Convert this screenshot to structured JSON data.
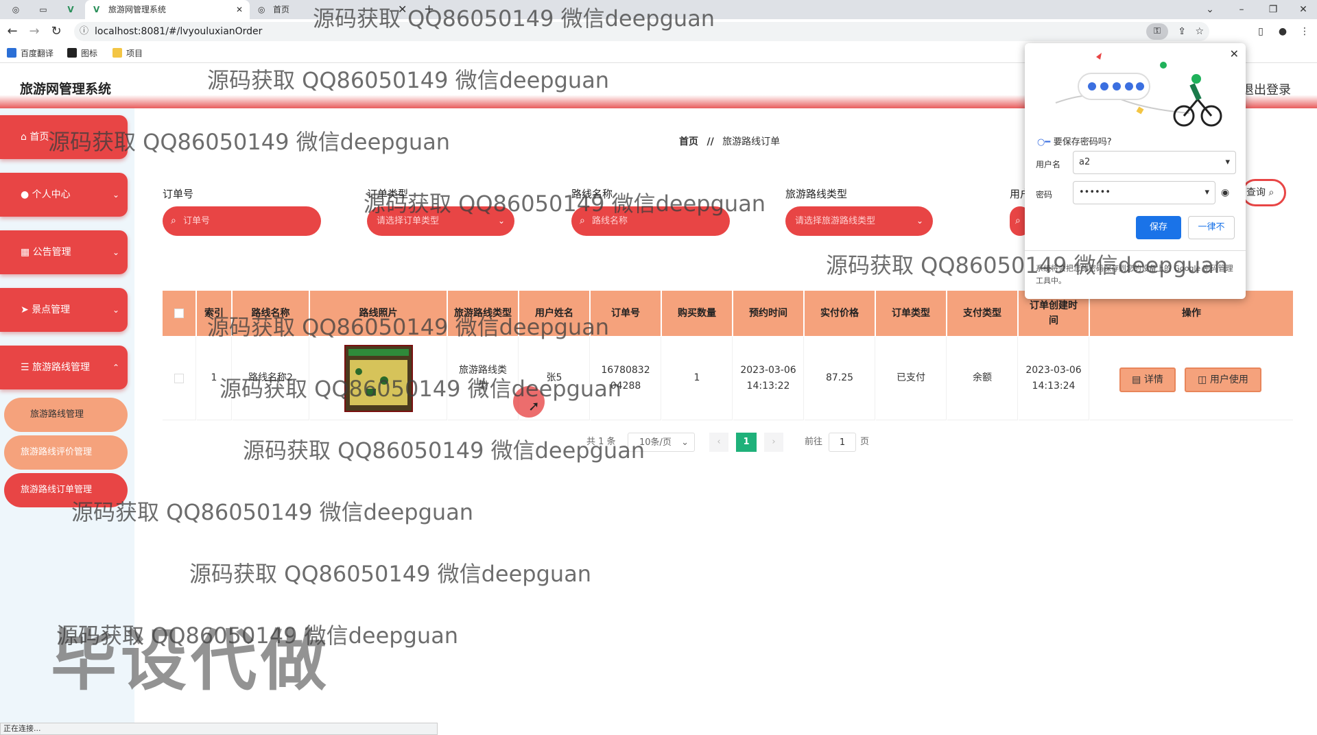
{
  "browser": {
    "tabs": [
      {
        "label": "旅游网管理系统",
        "active": true
      },
      {
        "label": "首页",
        "active": false
      }
    ],
    "url": "localhost:8081/#/lvyouluxianOrder",
    "bookmarks": [
      "百度翻译",
      "图标",
      "项目"
    ],
    "status_text": "正在连接..."
  },
  "app": {
    "title": "旅游网管理系统",
    "logout": "退出登录",
    "accent": "#e84545",
    "header_color": "#f5a27c"
  },
  "sidebar": {
    "items": [
      {
        "label": "首页"
      },
      {
        "label": "个人中心"
      },
      {
        "label": "公告管理"
      },
      {
        "label": "景点管理"
      },
      {
        "label": "旅游路线管理"
      }
    ],
    "subitems": [
      {
        "label": "旅游路线管理"
      },
      {
        "label": "旅游路线评价管理"
      },
      {
        "label": "旅游路线订单管理"
      }
    ]
  },
  "breadcrumb": {
    "home": "首页",
    "sep": "//",
    "current": "旅游路线订单"
  },
  "filters": [
    {
      "label": "订单号",
      "placeholder": "订单号"
    },
    {
      "label": "订单类型",
      "placeholder": "请选择订单类型"
    },
    {
      "label": "路线名称",
      "placeholder": "路线名称"
    },
    {
      "label": "旅游路线类型",
      "placeholder": "请选择旅游路线类型"
    },
    {
      "label": "用户"
    }
  ],
  "query_button": "查询",
  "table": {
    "headers": [
      "索引",
      "路线名称",
      "路线照片",
      "旅游路线类型",
      "用户姓名",
      "订单号",
      "购买数量",
      "预约时间",
      "实付价格",
      "订单类型",
      "支付类型",
      "订单创建时间",
      "操作"
    ],
    "rows": [
      {
        "index": "1",
        "route": "路线名称2",
        "type": "旅游路线类型",
        "user": "张5",
        "order_no": "1678083204288",
        "qty": "1",
        "reserve_time": "2023-03-06 14:13:22",
        "price": "87.25",
        "order_type": "已支付",
        "pay_type": "余额",
        "created": "2023-03-06 14:13:24",
        "btn_detail": "详情",
        "btn_use": "用户使用"
      }
    ]
  },
  "pagination": {
    "total": "共 1 条",
    "page_size": "10条/页",
    "current": "1",
    "goto": "前往",
    "goto_value": "1",
    "page_unit": "页"
  },
  "password_popup": {
    "title": "要保存密码吗?",
    "username_label": "用户名",
    "username_value": "a2",
    "password_label": "密码",
    "password_value": "••••••",
    "save": "保存",
    "never": "一律不",
    "footer": "系统将会把您的密码保存到您的设备上的 Google 密码管理工具中。"
  },
  "watermark": {
    "text": "源码获取 QQ86050149 微信deepguan",
    "big_text": "毕设代做"
  }
}
